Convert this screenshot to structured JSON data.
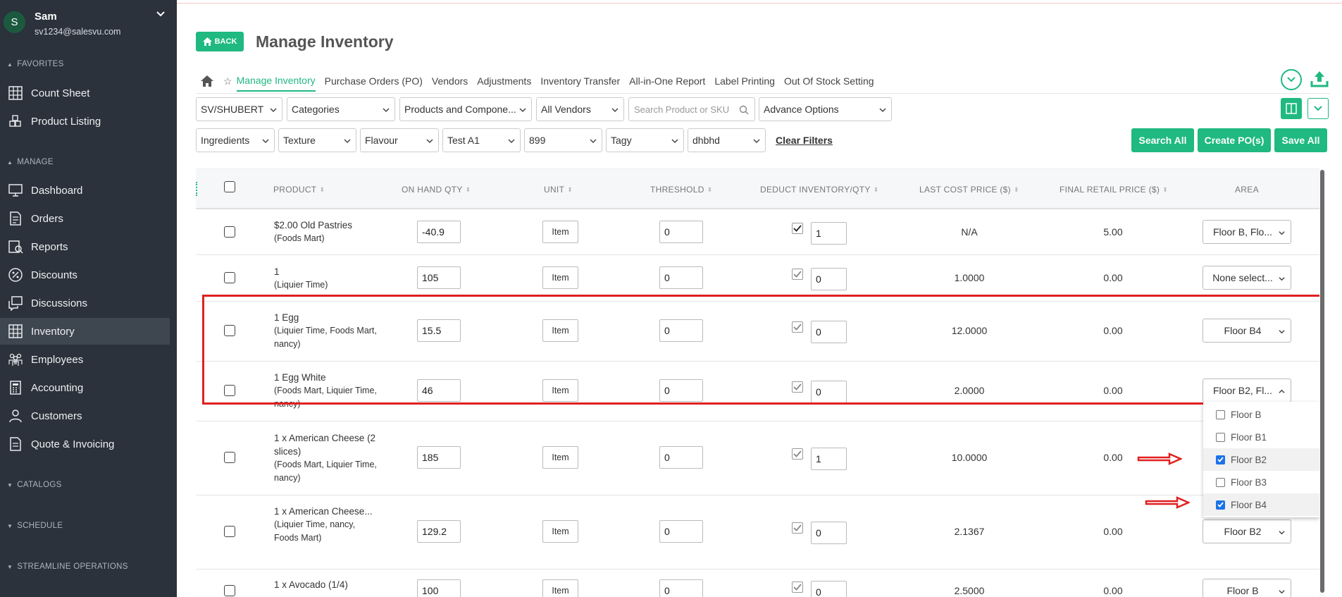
{
  "user": {
    "name": "Sam",
    "email": "sv1234@salesvu.com",
    "initial": "S"
  },
  "sidebar": {
    "favorites_label": "FAVORITES",
    "favorites": [
      {
        "label": "Count Sheet",
        "icon": "grid-icon"
      },
      {
        "label": "Product Listing",
        "icon": "boxes-icon"
      }
    ],
    "manage_label": "MANAGE",
    "manage": [
      {
        "label": "Dashboard",
        "icon": "monitor-icon"
      },
      {
        "label": "Orders",
        "icon": "document-icon"
      },
      {
        "label": "Reports",
        "icon": "report-icon"
      },
      {
        "label": "Discounts",
        "icon": "percent-icon"
      },
      {
        "label": "Discussions",
        "icon": "chat-icon"
      },
      {
        "label": "Inventory",
        "icon": "grid-icon",
        "active": true
      },
      {
        "label": "Employees",
        "icon": "people-icon"
      },
      {
        "label": "Accounting",
        "icon": "calculator-icon"
      },
      {
        "label": "Customers",
        "icon": "person-icon"
      },
      {
        "label": "Quote & Invoicing",
        "icon": "invoice-icon"
      }
    ],
    "catalogs_label": "CATALOGS",
    "schedule_label": "SCHEDULE",
    "streamline_label": "STREAMLINE OPERATIONS"
  },
  "header": {
    "back_label": "BACK",
    "title": "Manage Inventory"
  },
  "tabs": [
    "Manage Inventory",
    "Purchase Orders (PO)",
    "Vendors",
    "Adjustments",
    "Inventory Transfer",
    "All-in-One Report",
    "Label Printing",
    "Out Of Stock Setting"
  ],
  "filters": {
    "row1": [
      "SV/SHUBERT",
      "Categories",
      "Products and Compone...",
      "All Vendors"
    ],
    "search_placeholder": "Search Product or SKU",
    "advance": "Advance Options",
    "row2": [
      "Ingredients",
      "Texture",
      "Flavour",
      "Test A1",
      "899",
      "Tagy",
      "dhbhd"
    ],
    "clear": "Clear Filters"
  },
  "actions": {
    "search_all": "Search All",
    "create_po": "Create PO(s)",
    "save_all": "Save All"
  },
  "columns": [
    "PRODUCT",
    "ON HAND QTY",
    "UNIT",
    "THRESHOLD",
    "DEDUCT INVENTORY/QTY",
    "LAST COST PRICE ($)",
    "FINAL RETAIL PRICE ($)",
    "AREA"
  ],
  "rows": [
    {
      "name": "$2.00 Old Pastries",
      "sub": "(Foods Mart)",
      "qty": "-40.9",
      "unit": "Item",
      "threshold": "0",
      "deduct": "1",
      "cost": "N/A",
      "retail": "5.00",
      "area": "Floor B, Flo..."
    },
    {
      "name": "1",
      "sub": "(Liquier Time)",
      "qty": "105",
      "unit": "Item",
      "threshold": "0",
      "deduct": "0",
      "cost": "1.0000",
      "retail": "0.00",
      "area": "None select..."
    },
    {
      "name": "1 Egg",
      "sub": "(Liquier Time, Foods Mart, nancy)",
      "qty": "15.5",
      "unit": "Item",
      "threshold": "0",
      "deduct": "0",
      "cost": "12.0000",
      "retail": "0.00",
      "area": "Floor B4"
    },
    {
      "name": "1 Egg White",
      "sub": "(Foods Mart, Liquier Time, nancy)",
      "qty": "46",
      "unit": "Item",
      "threshold": "0",
      "deduct": "0",
      "cost": "2.0000",
      "retail": "0.00",
      "area": "Floor B2, Fl..."
    },
    {
      "name": "1 x American Cheese (2 slices)",
      "sub": "(Foods Mart, Liquier Time, nancy)",
      "qty": "185",
      "unit": "Item",
      "threshold": "0",
      "deduct": "1",
      "cost": "10.0000",
      "retail": "0.00",
      "area": ""
    },
    {
      "name": "1 x American Cheese...",
      "sub": "(Liquier Time, nancy, Foods Mart)",
      "qty": "129.2",
      "unit": "Item",
      "threshold": "0",
      "deduct": "0",
      "cost": "2.1367",
      "retail": "0.00",
      "area": "Floor B2"
    },
    {
      "name": "1 x Avocado (1/4)",
      "sub": "",
      "qty": "100",
      "unit": "Item",
      "threshold": "0",
      "deduct": "0",
      "cost": "2.5000",
      "retail": "0.00",
      "area": "Floor B"
    }
  ],
  "area_dropdown": [
    {
      "label": "Floor B",
      "checked": false
    },
    {
      "label": "Floor B1",
      "checked": false
    },
    {
      "label": "Floor B2",
      "checked": true
    },
    {
      "label": "Floor B3",
      "checked": false
    },
    {
      "label": "Floor B4",
      "checked": true
    }
  ],
  "colors": {
    "accent": "#1fb981",
    "sidebar": "#2b323c",
    "highlight": "#e02020"
  }
}
